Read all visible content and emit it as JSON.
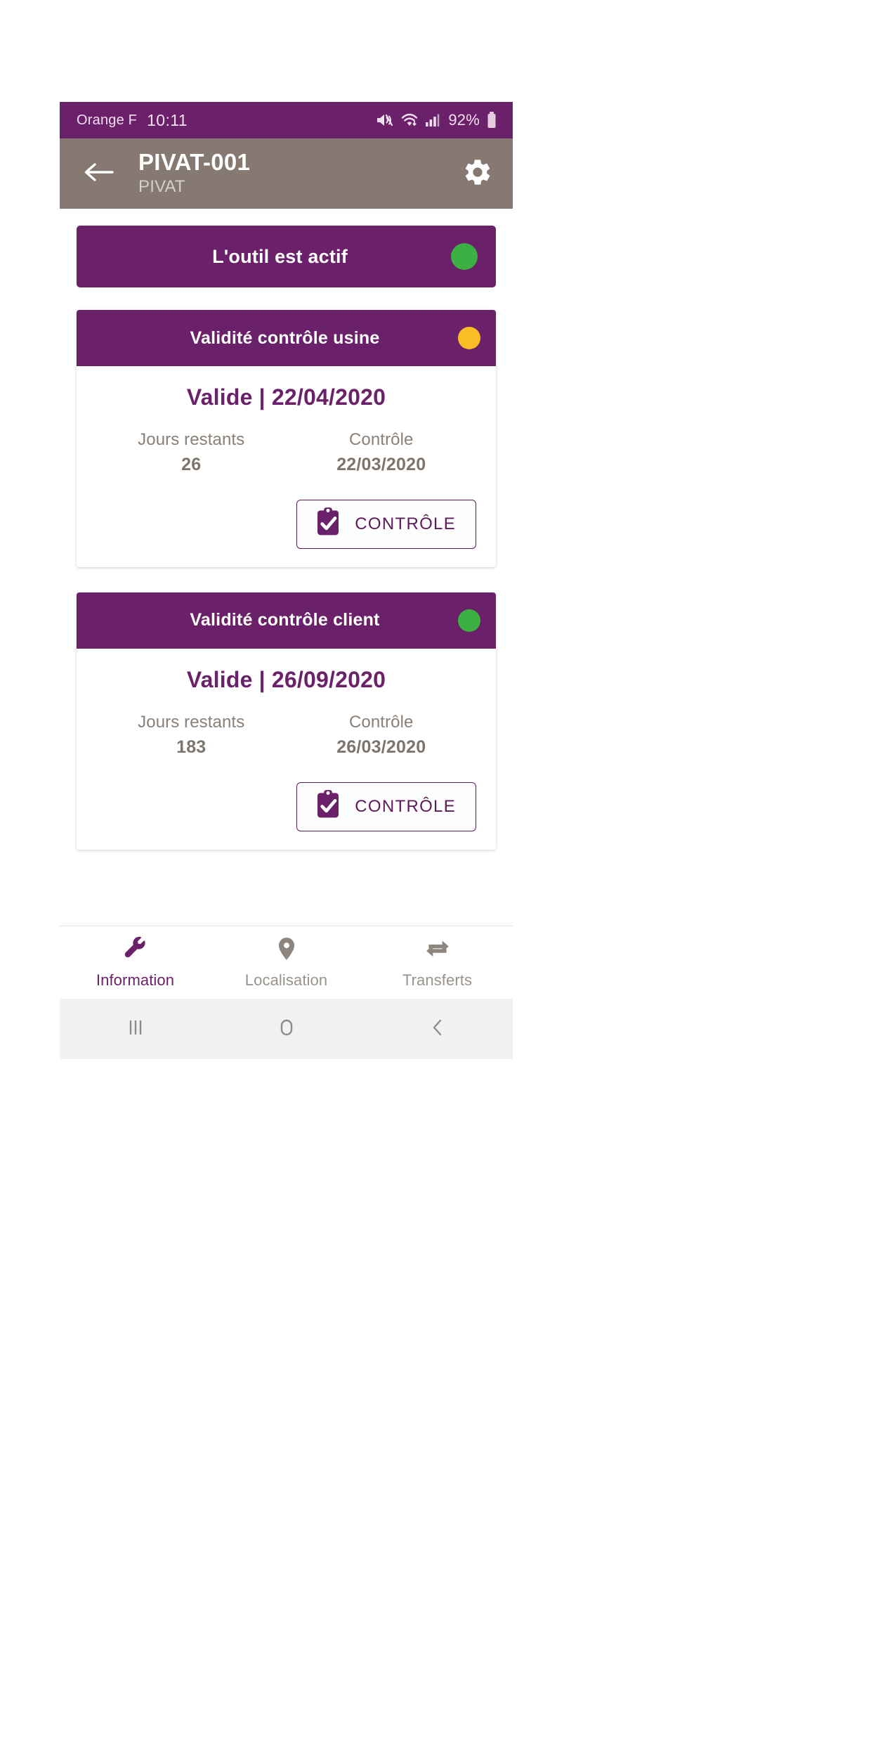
{
  "status_bar": {
    "carrier": "Orange F",
    "time": "10:11",
    "battery_percent": "92%",
    "icons": [
      "mute-icon",
      "wifi-icon",
      "signal-icon",
      "battery-icon"
    ],
    "background_color": "#6b2169"
  },
  "app_bar": {
    "back_icon": "arrow-left-icon",
    "title": "PIVAT-001",
    "subtitle": "PIVAT",
    "settings_icon": "gear-icon",
    "background_color": "#857972"
  },
  "active_banner": {
    "label": "L'outil est actif",
    "indicator_color": "#3cb043"
  },
  "cards": [
    {
      "title": "Validité contrôle usine",
      "indicator_color": "#f9bd25",
      "status": "Valide | 22/04/2020",
      "fields": [
        {
          "label": "Jours restants",
          "value": "26"
        },
        {
          "label": "Contrôle",
          "value": "22/03/2020"
        }
      ],
      "button": {
        "label": "CONTRÔLE",
        "icon": "clipboard-check-icon"
      }
    },
    {
      "title": "Validité contrôle client",
      "indicator_color": "#3cb043",
      "status": "Valide | 26/09/2020",
      "fields": [
        {
          "label": "Jours restants",
          "value": "183"
        },
        {
          "label": "Contrôle",
          "value": "26/03/2020"
        }
      ],
      "button": {
        "label": "CONTRÔLE",
        "icon": "clipboard-check-icon"
      }
    }
  ],
  "bottom_nav": {
    "items": [
      {
        "label": "Information",
        "icon": "wrench-icon",
        "active": true
      },
      {
        "label": "Localisation",
        "icon": "map-pin-icon",
        "active": false
      },
      {
        "label": "Transferts",
        "icon": "transfer-arrows-icon",
        "active": false
      }
    ],
    "active_color": "#6b2169",
    "inactive_color": "#9a938c"
  },
  "system_nav": {
    "recents_icon": "recents-icon",
    "home_icon": "home-icon",
    "back_icon": "back-chevron-icon"
  },
  "theme": {
    "primary": "#6b2169",
    "app_bar": "#857972",
    "green": "#3cb043",
    "amber": "#f9bd25"
  }
}
